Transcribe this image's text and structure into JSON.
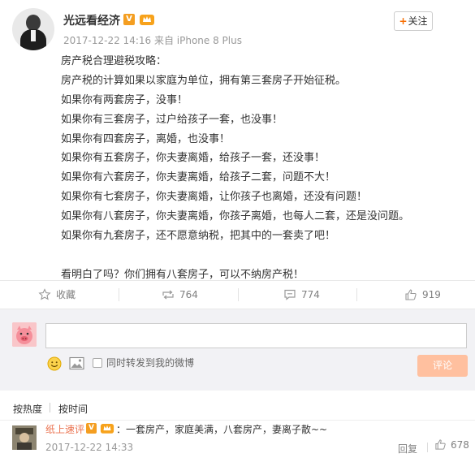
{
  "post": {
    "author": "光远看经济",
    "verified_badge": "V",
    "meta": "2017-12-22 14:16 来自 iPhone 8 Plus",
    "follow_label": "关注",
    "paragraphs": [
      "房产税合理避税攻略：",
      "房产税的计算如果以家庭为单位，拥有第三套房子开始征税。",
      "如果你有两套房子，没事！",
      "如果你有三套房子，过户给孩子一套，也没事！",
      "如果你有四套房子，离婚，也没事！",
      "如果你有五套房子，你夫妻离婚，给孩子一套，还没事！",
      "如果你有六套房子，你夫妻离婚，给孩子二套，问题不大！",
      "如果你有七套房子，你夫妻离婚，让你孩子也离婚，还没有问题！",
      "如果你有八套房子，你夫妻离婚，你孩子离婚，也每人二套，还是没问题。",
      "如果你有九套房子，还不愿意纳税，把其中的一套卖了吧！",
      "",
      "看明白了吗？你们拥有八套房子，可以不纳房产税！"
    ]
  },
  "actions": {
    "favorite_label": "收藏",
    "repost_count": "764",
    "comment_count": "774",
    "like_count": "919"
  },
  "compose": {
    "input_value": "",
    "forward_label": "同时转发到我的微博",
    "submit_label": "评论"
  },
  "sort": {
    "hot_label": "按热度",
    "time_label": "按时间"
  },
  "comment": {
    "user": "纸上速评",
    "verified_badge": "V",
    "text": "：一套房产，家庭美满，八套房产，妻离子散~~",
    "time": "2017-12-22 14:33",
    "reply_label": "回复",
    "like_count": "678"
  },
  "colors": {
    "accent_orange": "#f76d00",
    "username_link": "#eb7350",
    "submit_disabled": "#ffc09f",
    "verified": "#f49e21"
  }
}
